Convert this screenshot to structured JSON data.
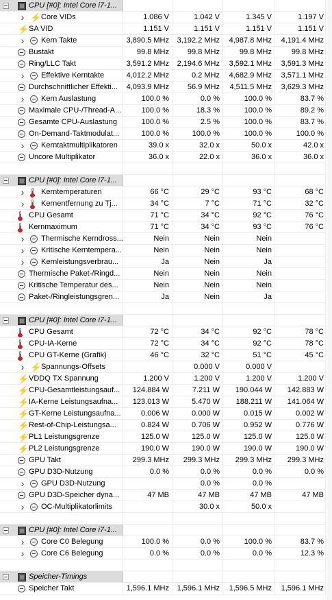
{
  "groups": [
    {
      "header": "CPU [#0]: Intel Core i7-1...",
      "rows": [
        {
          "icon": "bolt",
          "expand": true,
          "label": "Core VIDs",
          "v": [
            "1.086 V",
            "1.042 V",
            "1.345 V",
            "1.197 V"
          ]
        },
        {
          "icon": "bolt",
          "expand": false,
          "label": "SA VID",
          "v": [
            "1.151 V",
            "1.151 V",
            "1.151 V",
            "1.151 V"
          ]
        },
        {
          "icon": "clock",
          "expand": true,
          "label": "Kern Takte",
          "v": [
            "3,890.5 MHz",
            "3,192.2 MHz",
            "4,987.8 MHz",
            "4,191.4 MHz"
          ]
        },
        {
          "icon": "clock",
          "expand": false,
          "label": "Bustakt",
          "v": [
            "99.8 MHz",
            "99.8 MHz",
            "99.8 MHz",
            "99.8 MHz"
          ]
        },
        {
          "icon": "clock",
          "expand": false,
          "label": "Ring/LLC Takt",
          "v": [
            "3,591.2 MHz",
            "2,194.6 MHz",
            "3,592.1 MHz",
            "3,591.3 MHz"
          ]
        },
        {
          "icon": "clock",
          "expand": true,
          "label": "Effektive Kerntakte",
          "v": [
            "4,012.2 MHz",
            "0.2 MHz",
            "4,682.9 MHz",
            "3,571.1 MHz"
          ]
        },
        {
          "icon": "clock",
          "expand": false,
          "label": "Durchschnittlicher Effekti...",
          "v": [
            "4,093.9 MHz",
            "56.9 MHz",
            "4,511.5 MHz",
            "3,629.3 MHz"
          ]
        },
        {
          "icon": "clock",
          "expand": true,
          "label": "Kern Auslastung",
          "v": [
            "100.0 %",
            "0.0 %",
            "100.0 %",
            "83.7 %"
          ]
        },
        {
          "icon": "clock",
          "expand": false,
          "label": "Maximale CPU-/Thread-A...",
          "v": [
            "100.0 %",
            "18.3 %",
            "100.0 %",
            "89.2 %"
          ]
        },
        {
          "icon": "clock",
          "expand": false,
          "label": "Gesamte CPU-Auslastung",
          "v": [
            "100.0 %",
            "2.5 %",
            "100.0 %",
            "83.7 %"
          ]
        },
        {
          "icon": "clock",
          "expand": false,
          "label": "On-Demand-Taktmodulat...",
          "v": [
            "100.0 %",
            "100.0 %",
            "100.0 %",
            "100.0 %"
          ]
        },
        {
          "icon": "clock",
          "expand": true,
          "label": "Kerntaktmultiplikatoren",
          "v": [
            "39.0 x",
            "32.0 x",
            "50.0 x",
            "42.0 x"
          ]
        },
        {
          "icon": "clock",
          "expand": false,
          "label": "Uncore Multiplikator",
          "v": [
            "36.0 x",
            "22.0 x",
            "36.0 x",
            "36.0 x"
          ]
        }
      ]
    },
    {
      "header": "CPU [#0]: Intel Core i7-1...",
      "rows": [
        {
          "icon": "therm",
          "expand": true,
          "label": "Kerntemperaturen",
          "v": [
            "66 °C",
            "29 °C",
            "93 °C",
            "68 °C"
          ]
        },
        {
          "icon": "therm",
          "expand": true,
          "label": "Kernentfernung zu Tj...",
          "v": [
            "34 °C",
            "7 °C",
            "71 °C",
            "32 °C"
          ]
        },
        {
          "icon": "therm",
          "expand": false,
          "label": "CPU Gesamt",
          "v": [
            "71 °C",
            "34 °C",
            "92 °C",
            "76 °C"
          ]
        },
        {
          "icon": "therm",
          "expand": false,
          "label": "Kernmaximum",
          "v": [
            "71 °C",
            "34 °C",
            "93 °C",
            "76 °C"
          ]
        },
        {
          "icon": "clock",
          "expand": true,
          "label": "Thermische Kerndross...",
          "v": [
            "Nein",
            "Nein",
            "Nein",
            ""
          ]
        },
        {
          "icon": "clock",
          "expand": true,
          "label": "Kritische Kerntempera...",
          "v": [
            "Nein",
            "Nein",
            "Nein",
            ""
          ]
        },
        {
          "icon": "clock",
          "expand": true,
          "label": "Kernleistungsverbrau...",
          "v": [
            "Ja",
            "Nein",
            "Ja",
            ""
          ]
        },
        {
          "icon": "clock",
          "expand": false,
          "label": "Thermische Paket-/Ringd...",
          "v": [
            "Nein",
            "Nein",
            "Nein",
            ""
          ]
        },
        {
          "icon": "clock",
          "expand": false,
          "label": "Kritische Temperatur des...",
          "v": [
            "Nein",
            "Nein",
            "Nein",
            ""
          ]
        },
        {
          "icon": "clock",
          "expand": false,
          "label": "Paket-/Ringleistungsgren...",
          "v": [
            "Ja",
            "Nein",
            "Ja",
            ""
          ]
        }
      ]
    },
    {
      "header": "CPU [#0]: Intel Core i7-1...",
      "rows": [
        {
          "icon": "therm",
          "expand": false,
          "label": "CPU Gesamt",
          "v": [
            "72 °C",
            "34 °C",
            "92 °C",
            "78 °C"
          ]
        },
        {
          "icon": "therm",
          "expand": false,
          "label": "CPU-IA-Kerne",
          "v": [
            "72 °C",
            "34 °C",
            "92 °C",
            "78 °C"
          ]
        },
        {
          "icon": "therm",
          "expand": false,
          "label": "CPU GT-Kerne (Grafik)",
          "v": [
            "46 °C",
            "32 °C",
            "51 °C",
            "45 °C"
          ]
        },
        {
          "icon": "bolt",
          "expand": true,
          "label": "Spannungs-Offsets",
          "v": [
            "",
            "0.000 V",
            "0.000 V",
            ""
          ]
        },
        {
          "icon": "bolt",
          "expand": false,
          "label": "VDDQ TX Spannung",
          "v": [
            "1.200 V",
            "1.200 V",
            "1.200 V",
            "1.200 V"
          ]
        },
        {
          "icon": "bolt",
          "expand": false,
          "label": "CPU-Gesamtleistungsauf...",
          "v": [
            "124.884 W",
            "7.211 W",
            "190.044 W",
            "142.883 W"
          ]
        },
        {
          "icon": "bolt",
          "expand": false,
          "label": "IA-Kerne Leistungsaufna...",
          "v": [
            "123.013 W",
            "5.470 W",
            "188.211 W",
            "141.064 W"
          ]
        },
        {
          "icon": "bolt",
          "expand": false,
          "label": "GT-Kerne Leistungsaufna...",
          "v": [
            "0.006 W",
            "0.000 W",
            "0.015 W",
            "0.002 W"
          ]
        },
        {
          "icon": "bolt",
          "expand": false,
          "label": "Rest-of-Chip-Leistungsa...",
          "v": [
            "0.824 W",
            "0.706 W",
            "0.952 W",
            "0.776 W"
          ]
        },
        {
          "icon": "bolt",
          "expand": false,
          "label": "PL1 Leistungsgrenze",
          "v": [
            "125.0 W",
            "125.0 W",
            "125.0 W",
            "125.0 W"
          ]
        },
        {
          "icon": "bolt",
          "expand": false,
          "label": "PL2 Leistungsgrenze",
          "v": [
            "190.0 W",
            "190.0 W",
            "190.0 W",
            "190.0 W"
          ]
        },
        {
          "icon": "clock",
          "expand": false,
          "label": "GPU Takt",
          "v": [
            "299.3 MHz",
            "299.3 MHz",
            "299.3 MHz",
            "299.3 MHz"
          ]
        },
        {
          "icon": "clock",
          "expand": false,
          "label": "GPU D3D-Nutzung",
          "v": [
            "0.0 %",
            "0.0 %",
            "0.0 %",
            "0.0 %"
          ]
        },
        {
          "icon": "clock",
          "expand": true,
          "label": "GPU D3D-Nutzung",
          "v": [
            "",
            "0.0 %",
            "0.0 %",
            ""
          ]
        },
        {
          "icon": "clock",
          "expand": false,
          "label": "GPU D3D-Speicher dyna...",
          "v": [
            "47 MB",
            "47 MB",
            "47 MB",
            "47 MB"
          ]
        },
        {
          "icon": "clock",
          "expand": true,
          "label": "OC-Multiplikatorlimits",
          "v": [
            "",
            "30.0 x",
            "50.0 x",
            ""
          ]
        }
      ]
    },
    {
      "header": "CPU [#0]: Intel Core i7-1...",
      "rows": [
        {
          "icon": "clock",
          "expand": true,
          "label": "Core C0 Belegung",
          "v": [
            "100.0 %",
            "0.0 %",
            "100.0 %",
            "83.7 %"
          ]
        },
        {
          "icon": "clock",
          "expand": true,
          "label": "Core C6 Belegung",
          "v": [
            "0.0 %",
            "0.0 %",
            "0.0 %",
            "12.3 %"
          ]
        }
      ]
    },
    {
      "header": "Speicher-Timings",
      "rows": [
        {
          "icon": "clock",
          "expand": false,
          "label": "Speicher Takt",
          "v": [
            "1,596.1 MHz",
            "1,596.1 MHz",
            "1,596.5 MHz",
            "1,596.1 MHz"
          ]
        }
      ]
    }
  ]
}
